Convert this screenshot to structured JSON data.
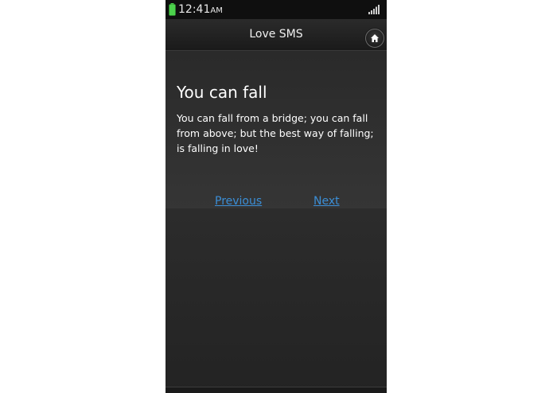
{
  "status_bar": {
    "time": "12:41",
    "ampm": "AM"
  },
  "header": {
    "title": "Love SMS"
  },
  "message": {
    "title": "You can fall",
    "body": "You can fall from a bridge; you can fall from above; but the best way of falling; is falling in love!"
  },
  "nav": {
    "previous_label": "Previous",
    "next_label": "Next",
    "link_color": "#3b8ed6"
  },
  "colors": {
    "battery": "#4cd24c",
    "background": "#262626"
  },
  "icons": {
    "battery": "battery-icon",
    "signal": "signal-icon",
    "home": "home-icon"
  }
}
